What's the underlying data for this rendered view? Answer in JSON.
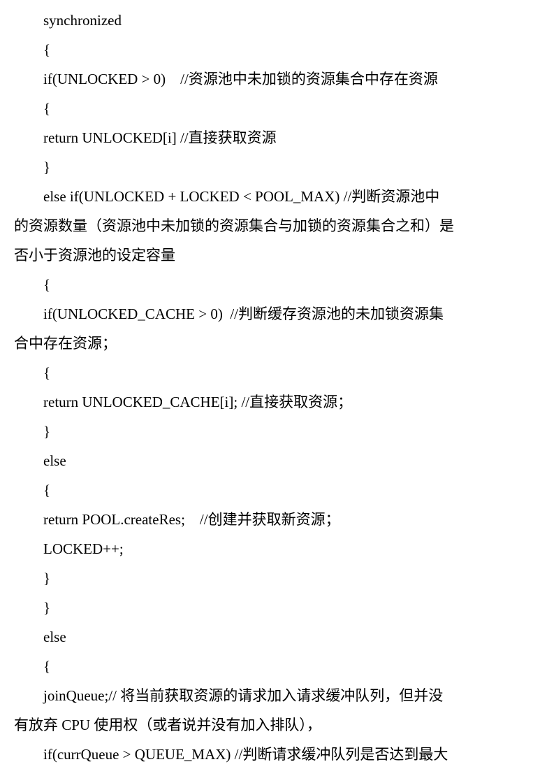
{
  "lines": [
    {
      "text": "synchronized",
      "indent": true
    },
    {
      "text": "{",
      "indent": true
    },
    {
      "text": "if(UNLOCKED > 0)    //资源池中未加锁的资源集合中存在资源",
      "indent": true
    },
    {
      "text": "{",
      "indent": true
    },
    {
      "text": "return UNLOCKED[i] //直接获取资源",
      "indent": true
    },
    {
      "text": "}",
      "indent": true
    },
    {
      "text": "else if(UNLOCKED + LOCKED < POOL_MAX) //判断资源池中",
      "indent": true
    },
    {
      "text": "的资源数量（资源池中未加锁的资源集合与加锁的资源集合之和）是",
      "indent": false
    },
    {
      "text": "否小于资源池的设定容量",
      "indent": false
    },
    {
      "text": "{",
      "indent": true
    },
    {
      "text": "if(UNLOCKED_CACHE > 0)  //判断缓存资源池的未加锁资源集",
      "indent": true
    },
    {
      "text": "合中存在资源；",
      "indent": false
    },
    {
      "text": "{",
      "indent": true
    },
    {
      "text": "return UNLOCKED_CACHE[i]; //直接获取资源；",
      "indent": true
    },
    {
      "text": "}",
      "indent": true
    },
    {
      "text": "else",
      "indent": true
    },
    {
      "text": "{",
      "indent": true
    },
    {
      "text": "return POOL.createRes;    //创建并获取新资源；",
      "indent": true
    },
    {
      "text": "LOCKED++;",
      "indent": true
    },
    {
      "text": "}",
      "indent": true
    },
    {
      "text": "}",
      "indent": true
    },
    {
      "text": "else",
      "indent": true
    },
    {
      "text": "{",
      "indent": true
    },
    {
      "text": "joinQueue;// 将当前获取资源的请求加入请求缓冲队列，但并没",
      "indent": true
    },
    {
      "text": "有放弃 CPU 使用权（或者说并没有加入排队），",
      "indent": false
    },
    {
      "text": "if(currQueue > QUEUE_MAX) //判断请求缓冲队列是否达到最大",
      "indent": true
    }
  ]
}
